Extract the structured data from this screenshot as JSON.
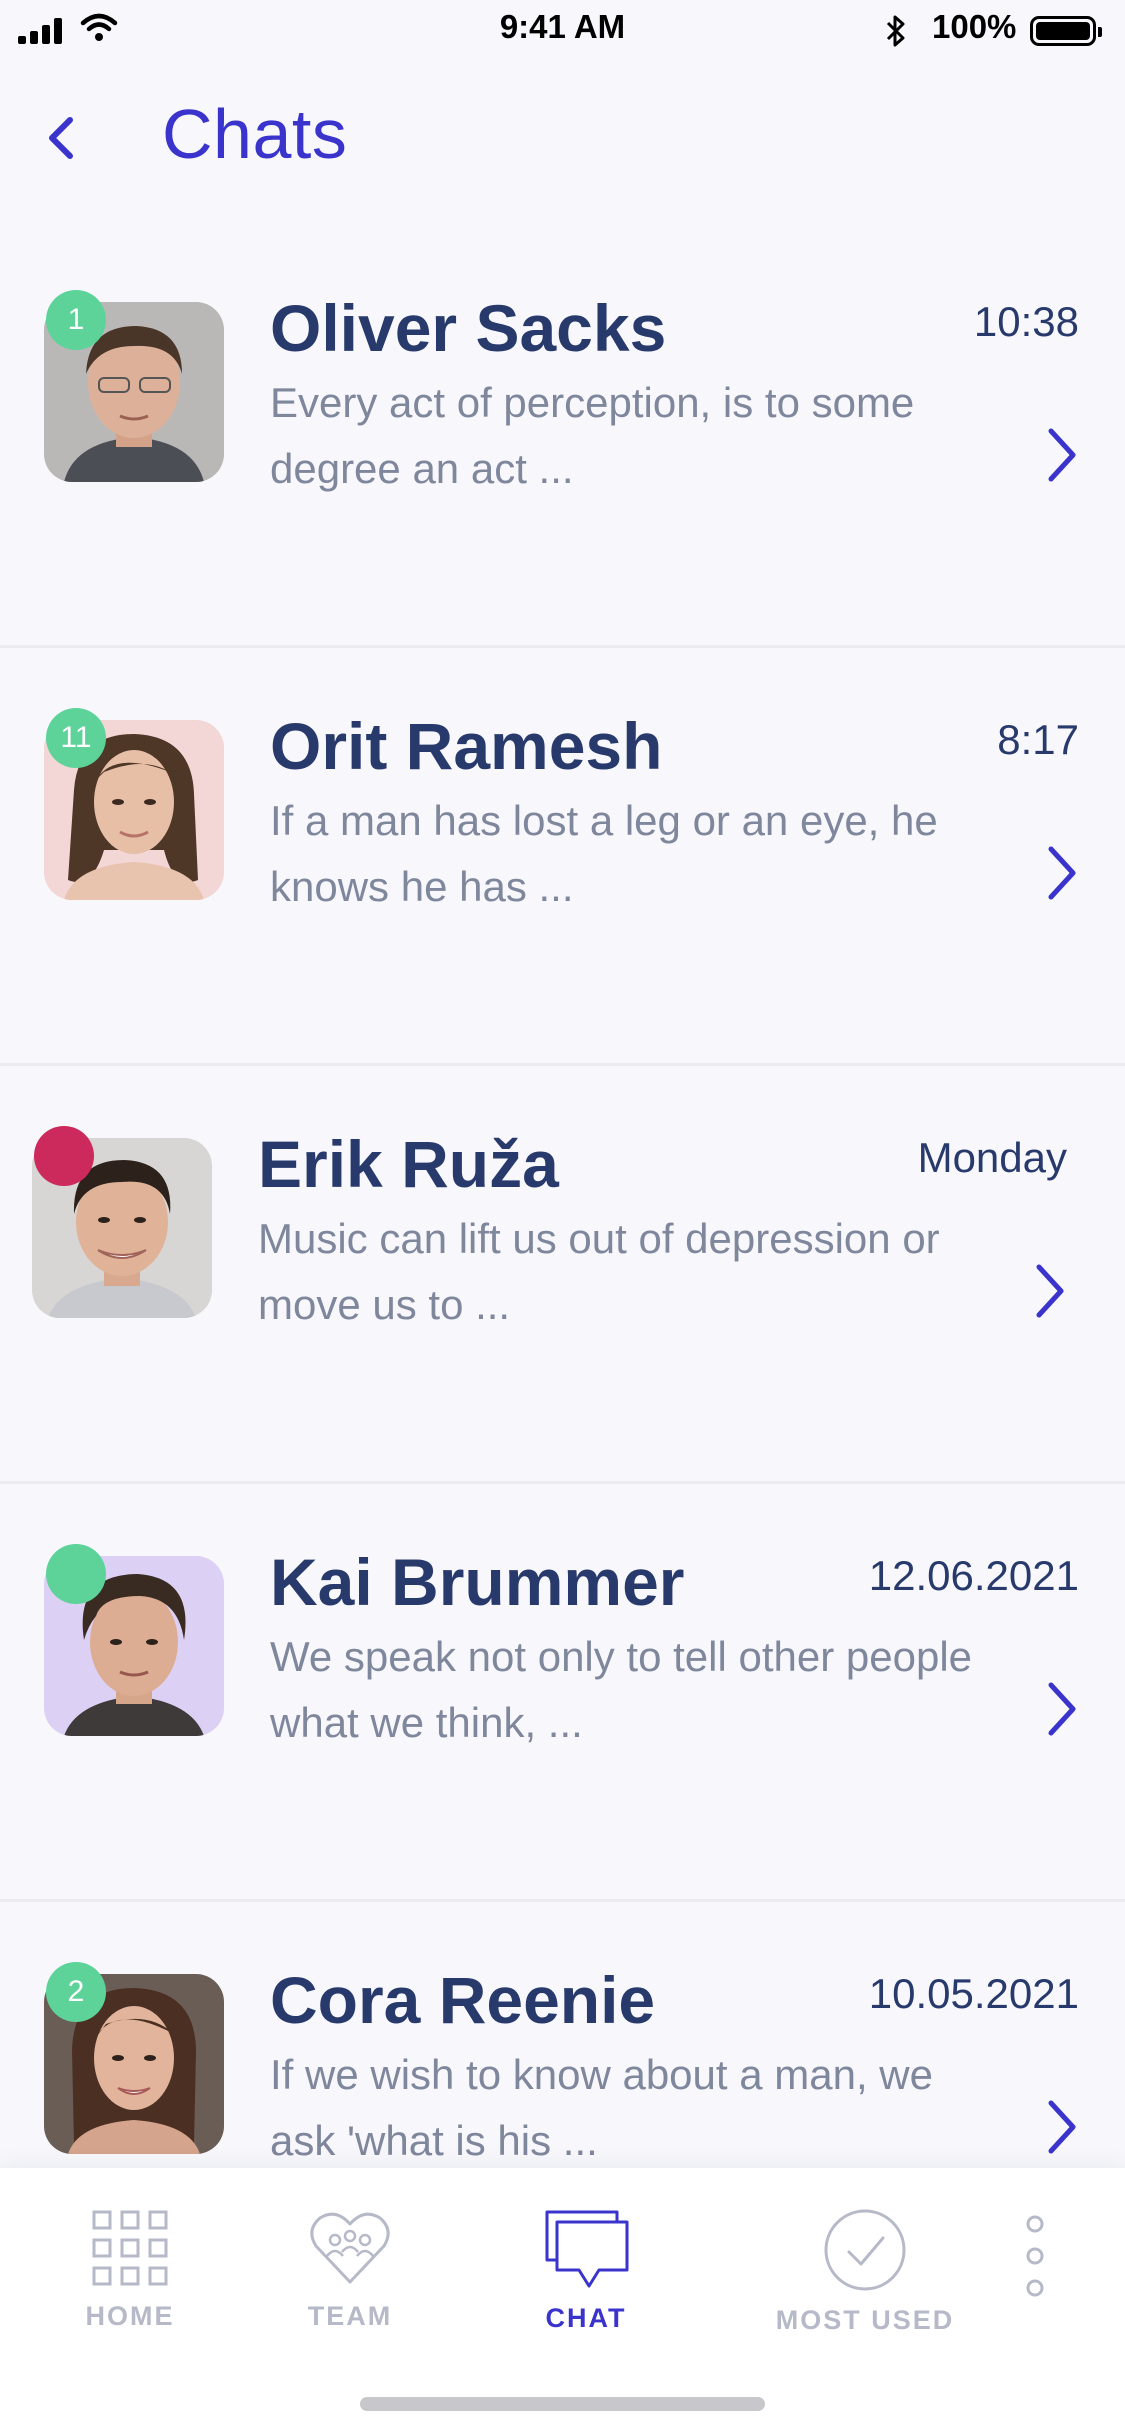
{
  "status_bar": {
    "time": "9:41 AM",
    "battery": "100%"
  },
  "header": {
    "title": "Chats"
  },
  "chats": [
    {
      "badge": "1",
      "name": "Oliver Sacks",
      "time": "10:38",
      "preview": "Every act of perception, is to some degree an act ..."
    },
    {
      "badge": "11",
      "name": "Orit Ramesh",
      "time": "8:17",
      "preview": "If a man has lost a leg or an eye, he knows he has ..."
    },
    {
      "badge": "",
      "name": "Erik Ruža",
      "time": "Monday",
      "preview": "Music can lift us out of depression or move us to ..."
    },
    {
      "badge": "",
      "name": "Kai Brummer",
      "time": "12.06.2021",
      "preview": "We speak not only to tell other people what we think, ..."
    },
    {
      "badge": "2",
      "name": "Cora Reenie",
      "time": "10.05.2021",
      "preview": "If we wish to know about a man, we ask 'what is his ..."
    }
  ],
  "colors": {
    "accent": "#3a34cc",
    "name_text": "#283a6c",
    "preview_text": "#7f879c",
    "badge_green": "#5dd39a",
    "badge_red": "#cc2a5c",
    "tab_inactive": "#b6b9c8"
  },
  "tabs": [
    {
      "label": "HOME",
      "icon": "grid-icon"
    },
    {
      "label": "TEAM",
      "icon": "heart-team-icon"
    },
    {
      "label": "CHAT",
      "icon": "chat-bubble-icon",
      "active": true
    },
    {
      "label": "MOST USED",
      "icon": "check-circle-icon"
    },
    {
      "label": "",
      "icon": "more-vertical-icon"
    }
  ]
}
